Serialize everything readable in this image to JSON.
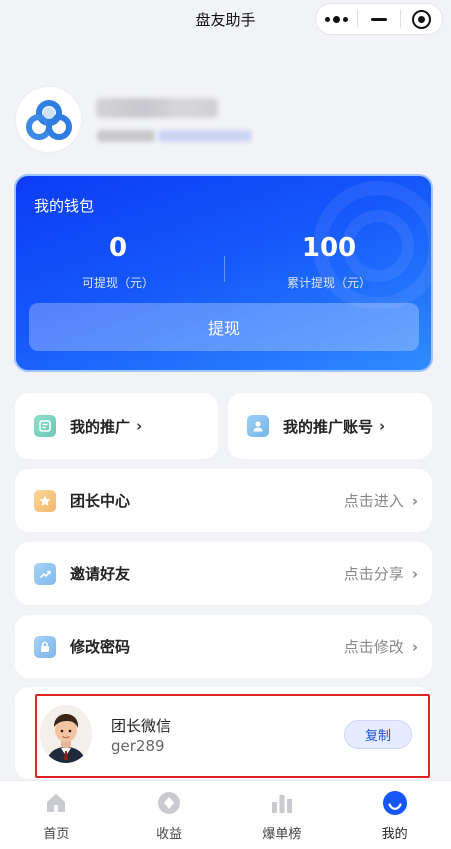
{
  "app": {
    "title": "盘友助手"
  },
  "capsule": {
    "more_icon": "more-dots-icon",
    "minimize_icon": "minimize-icon",
    "close_icon": "target-close-icon"
  },
  "profile": {
    "logo_icon": "panyou-logo-icon"
  },
  "wallet": {
    "title": "我的钱包",
    "available_value": "0",
    "available_label": "可提现（元）",
    "total_value": "100",
    "total_label": "累计提现（元）",
    "withdraw_label": "提现"
  },
  "menu": {
    "my_promotion": {
      "label": "我的推广",
      "chevron": "›",
      "icon": "promotion-doc-icon"
    },
    "my_promo_account": {
      "label": "我的推广账号",
      "chevron": "›",
      "icon": "account-person-icon"
    },
    "leader_center": {
      "label": "团长中心",
      "action": "点击进入",
      "chevron": "›",
      "icon": "star-icon"
    },
    "invite_friends": {
      "label": "邀请好友",
      "action": "点击分享",
      "chevron": "›",
      "icon": "share-arrow-icon"
    },
    "change_password": {
      "label": "修改密码",
      "action": "点击修改",
      "chevron": "›",
      "icon": "lock-icon"
    }
  },
  "leader": {
    "name_label": "团长微信",
    "wechat_id": "ger289",
    "copy_label": "复制"
  },
  "tabs": [
    {
      "label": "首页",
      "icon": "home-icon",
      "active": false
    },
    {
      "label": "收益",
      "icon": "earnings-icon",
      "active": false
    },
    {
      "label": "爆单榜",
      "icon": "bar-chart-icon",
      "active": false
    },
    {
      "label": "我的",
      "icon": "profile-icon",
      "active": true
    }
  ],
  "colors": {
    "accent": "#1557fa",
    "highlight_border": "#e02424"
  }
}
